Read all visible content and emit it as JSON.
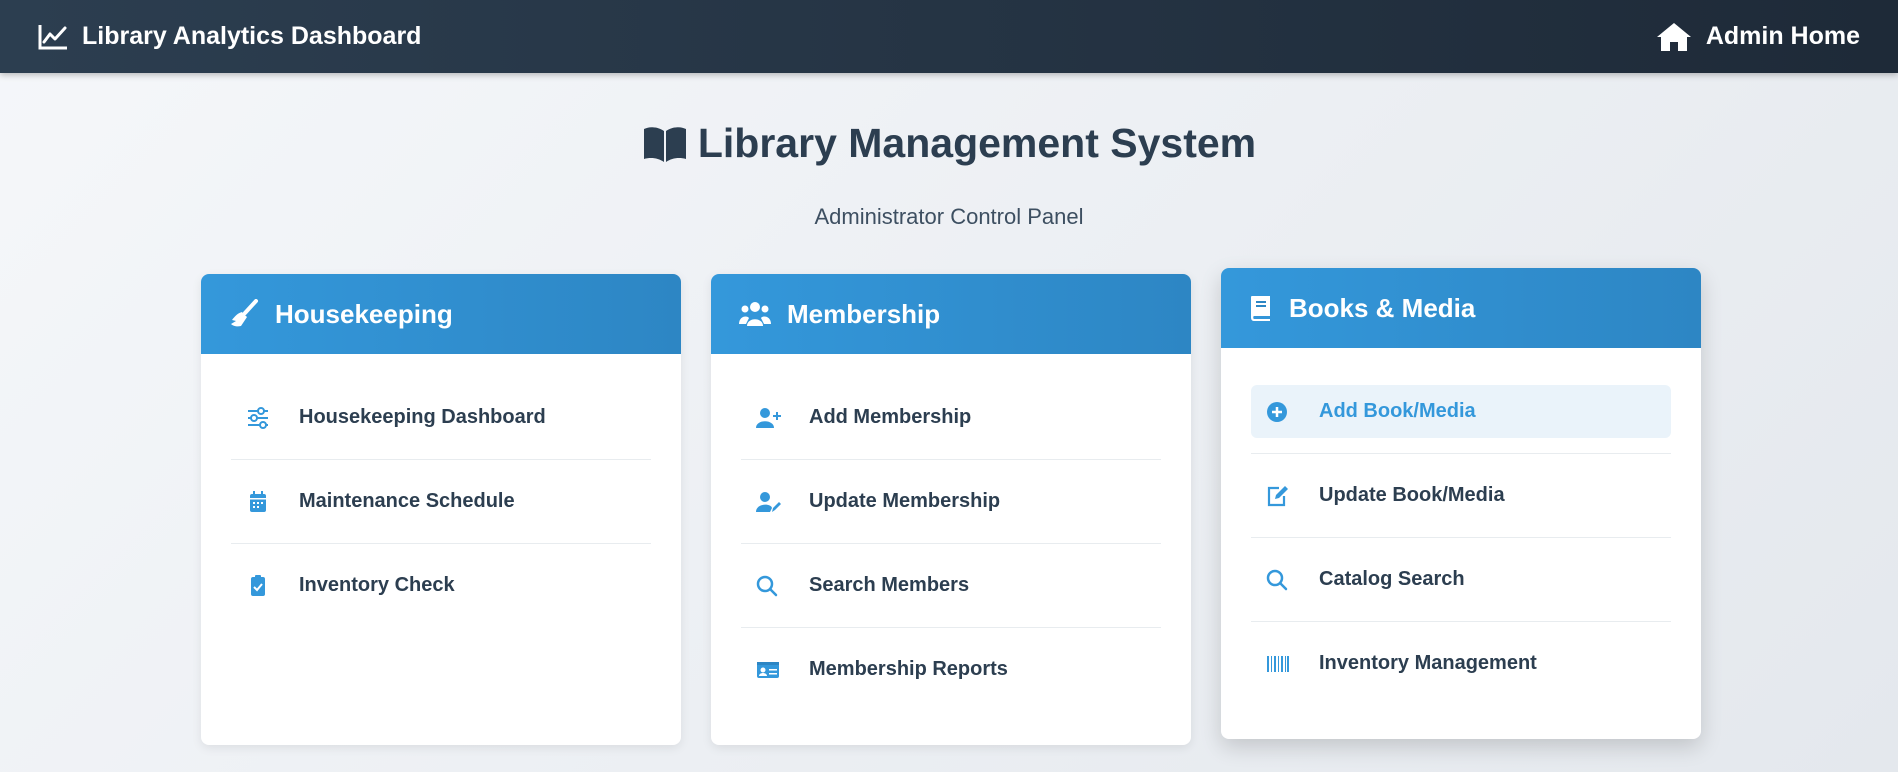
{
  "topbar": {
    "brand": "Library Analytics Dashboard",
    "home": "Admin Home"
  },
  "page": {
    "title": "Library Management System",
    "subtitle": "Administrator Control Panel"
  },
  "cards": [
    {
      "title": "Housekeeping",
      "icon": "broom-icon",
      "items": [
        {
          "label": "Housekeeping Dashboard",
          "icon": "sliders-icon"
        },
        {
          "label": "Maintenance Schedule",
          "icon": "calendar-icon"
        },
        {
          "label": "Inventory Check",
          "icon": "clipboard-check-icon"
        }
      ]
    },
    {
      "title": "Membership",
      "icon": "users-icon",
      "items": [
        {
          "label": "Add Membership",
          "icon": "user-plus-icon"
        },
        {
          "label": "Update Membership",
          "icon": "user-edit-icon"
        },
        {
          "label": "Search Members",
          "icon": "search-icon"
        },
        {
          "label": "Membership Reports",
          "icon": "id-card-icon"
        }
      ]
    },
    {
      "title": "Books & Media",
      "icon": "book-icon",
      "items": [
        {
          "label": "Add Book/Media",
          "icon": "plus-circle-icon",
          "active": true
        },
        {
          "label": "Update Book/Media",
          "icon": "edit-icon"
        },
        {
          "label": "Catalog Search",
          "icon": "search-icon"
        },
        {
          "label": "Inventory Management",
          "icon": "barcode-icon"
        }
      ]
    }
  ],
  "colors": {
    "accent": "#3498db",
    "nav": "#2c3e50",
    "text": "#2c3e50",
    "active_bg": "#eaf3fa"
  }
}
